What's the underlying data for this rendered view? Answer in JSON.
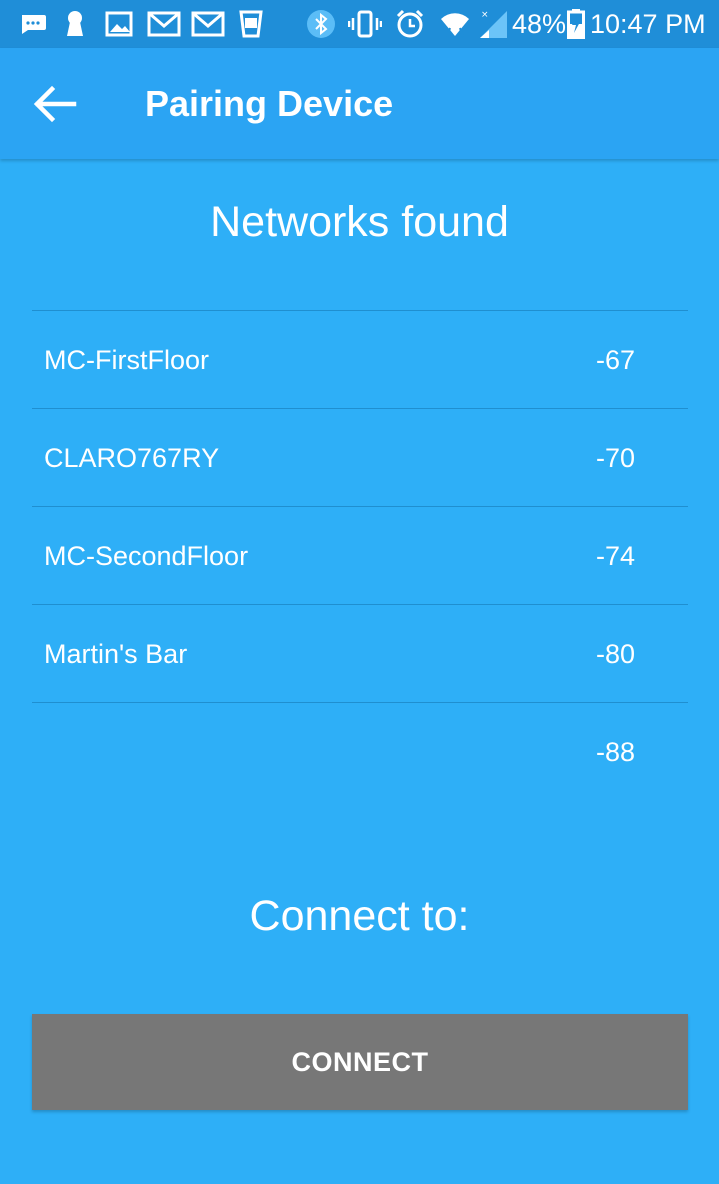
{
  "status_bar": {
    "battery_percent": "48%",
    "time": "10:47 PM",
    "icons": [
      "message-icon",
      "keyhole-icon",
      "image-icon",
      "gmail-icon",
      "gmail-icon",
      "cup-icon",
      "bluetooth-icon",
      "vibrate-icon",
      "alarm-icon",
      "wifi-icon",
      "signal-icon",
      "battery-icon"
    ]
  },
  "appbar": {
    "title": "Pairing Device",
    "back_icon": "arrow-left-icon"
  },
  "networks": {
    "heading": "Networks found",
    "items": [
      {
        "name": "MC-FirstFloor",
        "rssi": "-67"
      },
      {
        "name": "CLARO767RY",
        "rssi": "-70"
      },
      {
        "name": "MC-SecondFloor",
        "rssi": "-74"
      },
      {
        "name": "Martin's Bar",
        "rssi": "-80"
      },
      {
        "name": "",
        "rssi": "-88"
      }
    ]
  },
  "connect": {
    "heading": "Connect to:",
    "button_label": "CONNECT"
  },
  "colors": {
    "background": "#2eaff7",
    "status_bar": "#1f8ed8",
    "app_bar": "#2ba4f3",
    "divider": "#1f8fd0",
    "button": "#777777"
  }
}
